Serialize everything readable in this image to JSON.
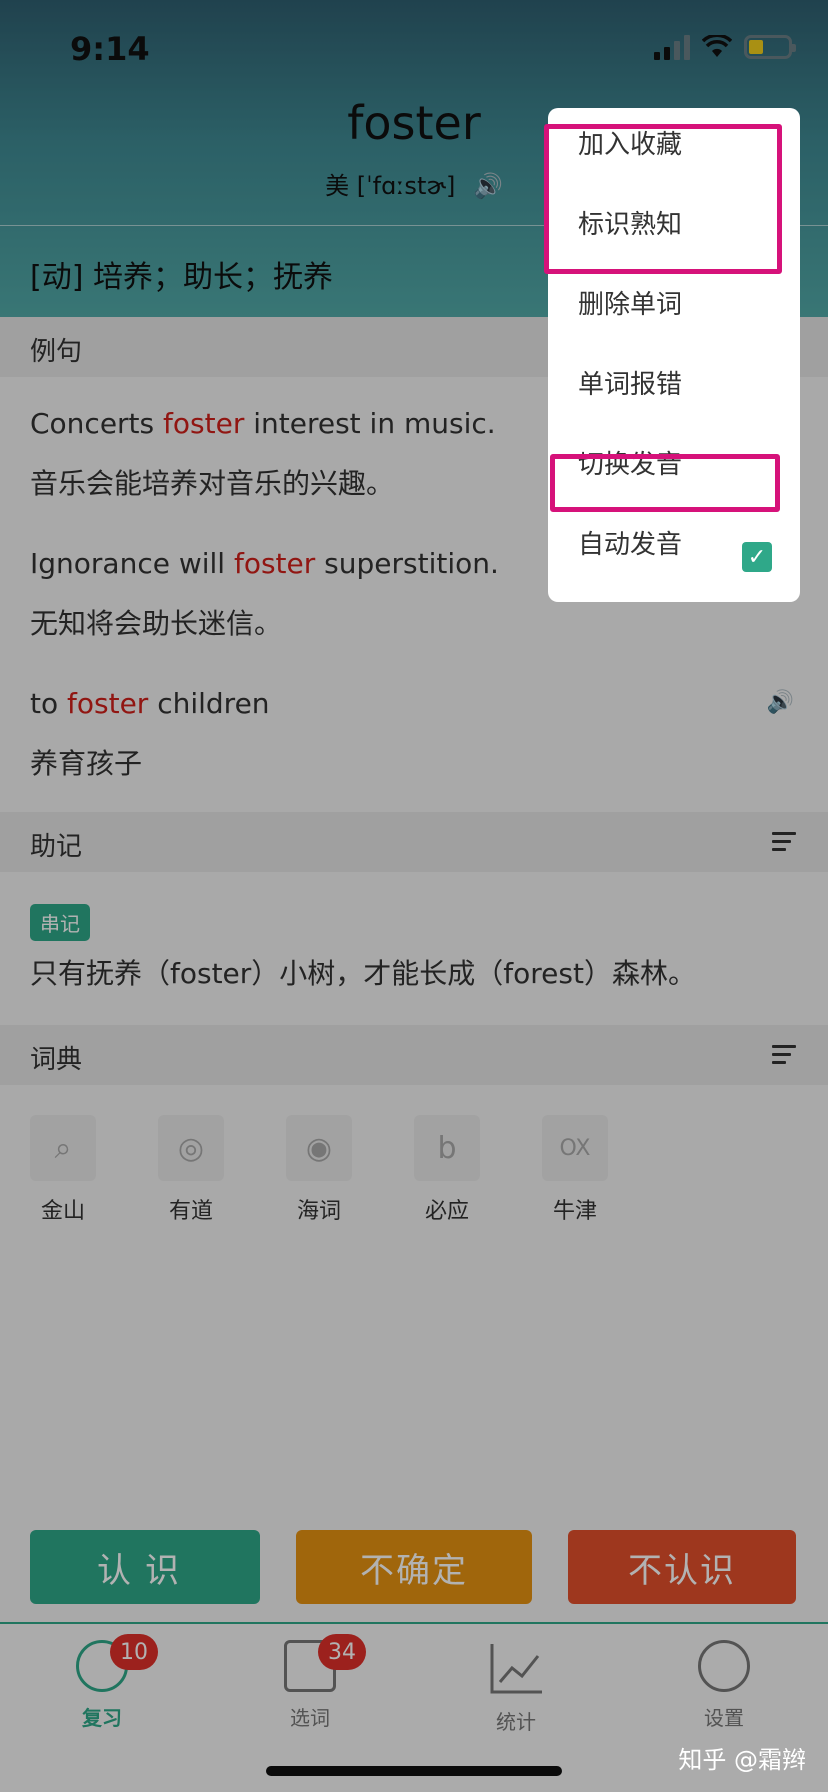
{
  "status": {
    "time": "9:14"
  },
  "word": {
    "text": "foster",
    "phonetic": "美 [ˈfɑːstɚ]",
    "definition": "[动] 培养；助长；抚养"
  },
  "sections": {
    "examples_title": "例句",
    "mnemonic_title": "助记",
    "dictionary_title": "词典"
  },
  "examples": [
    {
      "en_pre": "Concerts ",
      "en_word": "foster",
      "en_post": " interest in music.",
      "cn": "音乐会能培养对音乐的兴趣。"
    },
    {
      "en_pre": "Ignorance will ",
      "en_word": "foster",
      "en_post": " superstition.",
      "cn": "无知将会助长迷信。"
    },
    {
      "en_pre": "to ",
      "en_word": "foster",
      "en_post": " children",
      "cn": "养育孩子"
    }
  ],
  "mnemonic": {
    "tag": "串记",
    "text": "只有抚养（foster）小树，才能长成（forest）森林。"
  },
  "dictionaries": [
    {
      "label": "金山",
      "icon": "kingsoft-icon"
    },
    {
      "label": "有道",
      "icon": "youdao-icon"
    },
    {
      "label": "海词",
      "icon": "dict-cn-icon"
    },
    {
      "label": "必应",
      "icon": "bing-icon"
    },
    {
      "label": "牛津",
      "icon": "oxford-icon",
      "glyph": "OX"
    }
  ],
  "buttons": {
    "know": "认识",
    "unsure": "不确定",
    "unknown": "不认识"
  },
  "tabs": [
    {
      "label": "复习",
      "badge": "10",
      "active": true
    },
    {
      "label": "选词",
      "badge": "34"
    },
    {
      "label": "统计"
    },
    {
      "label": "设置"
    }
  ],
  "dropdown": {
    "items": [
      "加入收藏",
      "标识熟知",
      "删除单词",
      "单词报错",
      "切换发音",
      "自动发音"
    ],
    "auto_play_checked": true
  },
  "watermark": "知乎 @霜辫",
  "colors": {
    "accent": "#2fa889",
    "highlight_word": "#d0201b",
    "annotation_box": "#d6127a",
    "unsure_button": "#e69212",
    "unknown_button": "#e2502c"
  }
}
